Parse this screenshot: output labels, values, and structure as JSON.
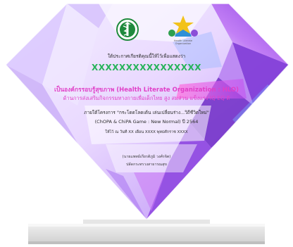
{
  "certificate": {
    "heading": "ใต้ประกาศเกียรติคุณนี้ให้ไว้เพื่อแสดงว่า",
    "recipient": "XXXXXXXXXXXXXXXX",
    "line1": "เป็นองค์กรรอบรู้สุขภาพ (Health Literate Organization : HLO)",
    "line2": "ด้านการส่งเสริมกิจกรรมทางกายเพื่อเด็กไทย สูง สมส่วน แข็งแรง IQ EQ ดี",
    "line3": "ภายใต้โครงการ \"กระโดดโลดเต้น เล่นเปลี่ยนร่าง...วิถีชีวิตใหม่\"",
    "line4": "(ChOPA & ChiPA Game : New Normal) ปี 2564",
    "date": "ให้ไว้ ณ วันที่ XX เดือน XXXX พุทธศักราช XXXX",
    "signer_name": "(นายแพทย์เกียรติภูมิ วงศ์รจิต)",
    "signer_title": "ปลัดกระทรวงสาธารณสุข",
    "logo_caption": "Health Literate Organization"
  },
  "colors": {
    "crystal_light": "#eadcff",
    "crystal_violet": "#a35cf0",
    "crystal_deep": "#6a2fc9",
    "crystal_pink": "#ff5fd2",
    "crystal_blue": "#7aa9ff",
    "recipient_green": "#27b35a",
    "title_pink": "#e040c8",
    "emblem_green": "#1f8a3d",
    "base_grey": "#d9d9d9"
  },
  "icons": {
    "left_logo": "ministry-of-public-health-emblem-icon",
    "right_logo": "health-literate-organization-logo-icon"
  }
}
